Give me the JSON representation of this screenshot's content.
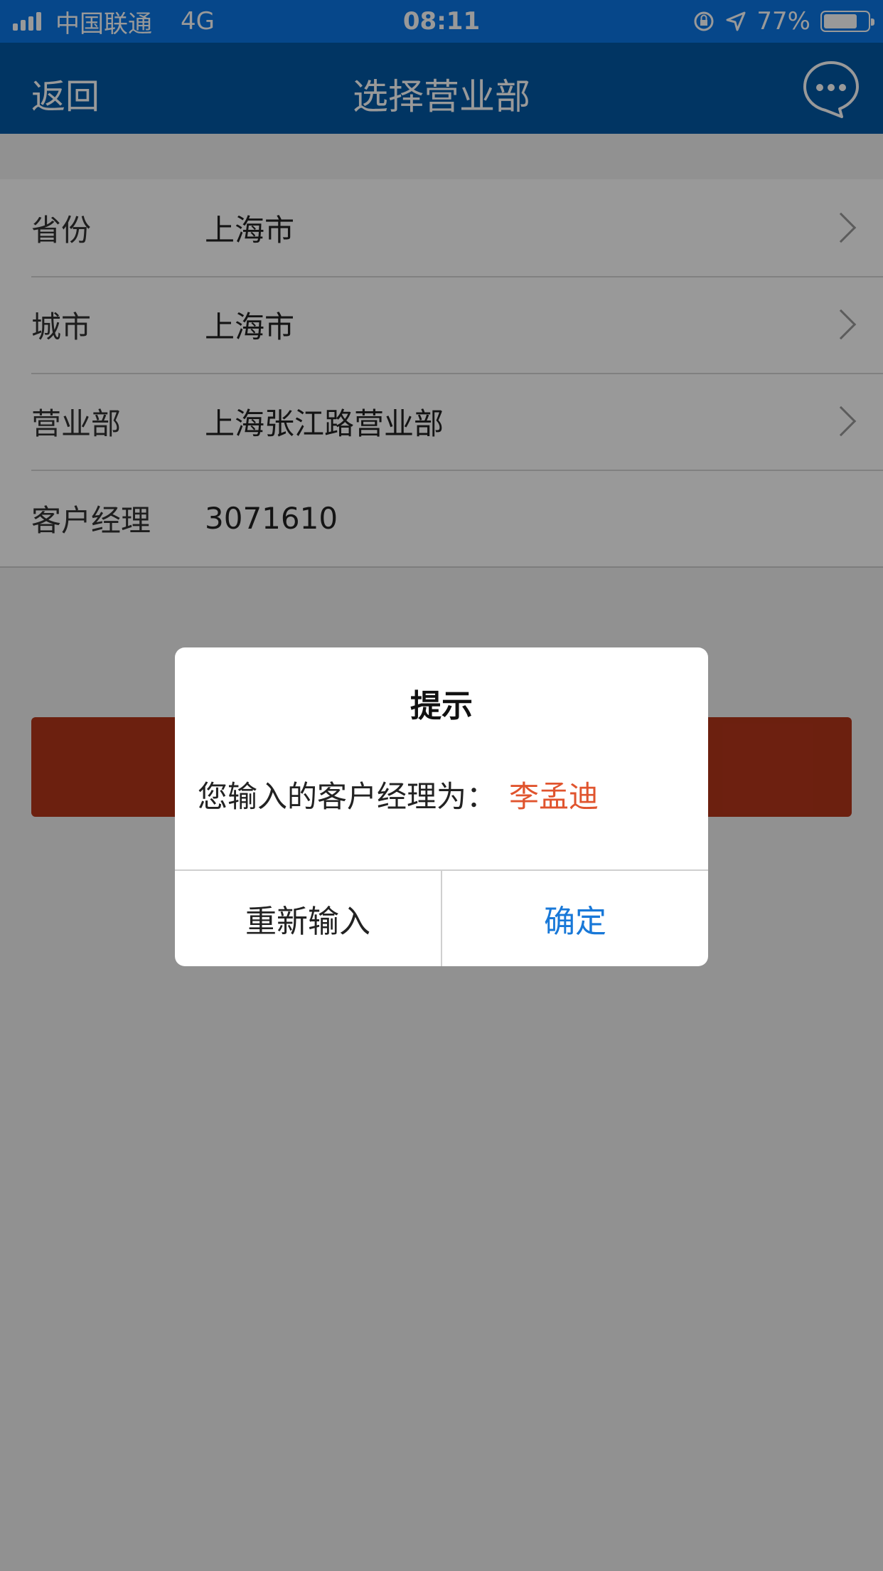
{
  "status_bar": {
    "carrier": "中国联通",
    "network": "4G",
    "time": "08:11",
    "battery": "77%"
  },
  "nav": {
    "back": "返回",
    "title": "选择营业部",
    "message_icon": "chat-bubble-icon"
  },
  "form": {
    "rows": [
      {
        "label": "省份",
        "value": "上海市"
      },
      {
        "label": "城市",
        "value": "上海市"
      },
      {
        "label": "营业部",
        "value": "上海张江路营业部"
      },
      {
        "label": "客户经理",
        "value": "3071610"
      }
    ]
  },
  "dialog": {
    "title": "提示",
    "message": "您输入的客户经理为：",
    "manager_name": "李孟迪",
    "cancel": "重新输入",
    "confirm": "确定"
  },
  "colors": {
    "status_bar": "#0a77e6",
    "nav_bar": "#0359a6",
    "submit_button": "#b5361a",
    "highlight_name": "#e0542e",
    "confirm_text": "#1878d8"
  },
  "icons": [
    "signal-icon",
    "orientation-lock-icon",
    "location-arrow-icon",
    "battery-icon",
    "chat-bubble-icon",
    "chevron-right-icon"
  ]
}
